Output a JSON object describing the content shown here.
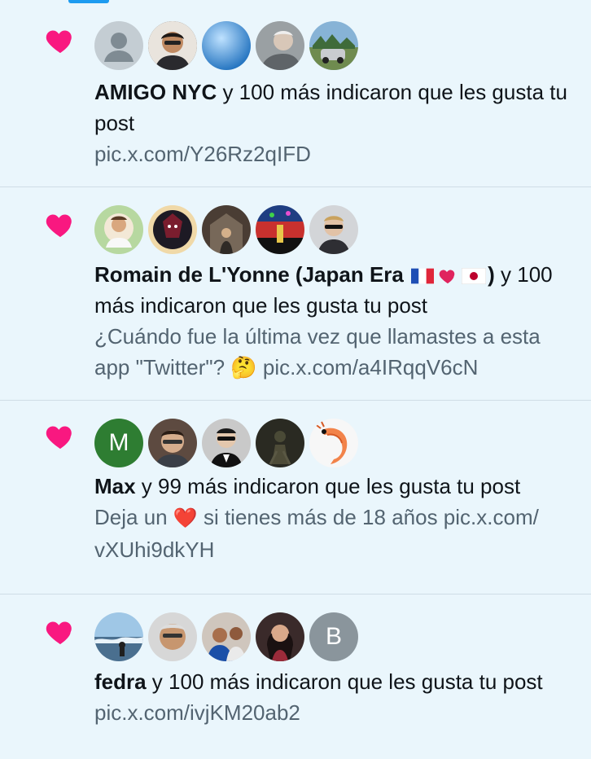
{
  "notifications": [
    {
      "name": "AMIGO NYC",
      "action": " y 100 más indicaron que les gusta tu post",
      "body": "pic.x.com/Y26Rz2qIFD",
      "avatars": [
        {
          "kind": "default-avatar",
          "color": "#c4cdd3"
        },
        {
          "kind": "photo",
          "color": "#3b2f2a"
        },
        {
          "kind": "photo",
          "color": "#2f87c9"
        },
        {
          "kind": "photo",
          "color": "#8b8f91"
        },
        {
          "kind": "photo",
          "color": "#6a8f5a"
        }
      ]
    },
    {
      "name_part1": "Romain de L'Yonne (Japan Era ",
      "name_part2": ")",
      "action": " y 100 más indicaron que les gusta tu post",
      "body_part1": "¿Cuándo fue la última vez que llamastes a esta app \"Twitter\"? ",
      "emoji_thinking": "🤔",
      "body_part2": " pic.x.com/a4IRqqV6cN",
      "avatars": [
        {
          "kind": "photo",
          "color": "#d9c8a7"
        },
        {
          "kind": "photo",
          "color": "#3a2a3e"
        },
        {
          "kind": "photo",
          "color": "#6b5b4b"
        },
        {
          "kind": "photo",
          "color": "#1f3e82"
        },
        {
          "kind": "photo",
          "color": "#b8b8b8"
        }
      ]
    },
    {
      "name": "Max",
      "action": " y 99 más indicaron que les gusta tu post",
      "body_part1": "Deja un ",
      "emoji_heart": "❤️",
      "body_part2": " si tienes más de 18 años pic.x.com/ vXUhi9dkYH",
      "avatars": [
        {
          "kind": "letter",
          "letter": "M",
          "color": "#2e7d32"
        },
        {
          "kind": "photo",
          "color": "#6e5a4e"
        },
        {
          "kind": "photo",
          "color": "#2b2b2b"
        },
        {
          "kind": "photo",
          "color": "#2a2a22"
        },
        {
          "kind": "shrimp",
          "color": "#f2f2f2"
        }
      ]
    },
    {
      "name": "fedra",
      "action": " y 100 más indicaron que les gusta tu post",
      "body": "pic.x.com/ivjKM20ab2",
      "avatars": [
        {
          "kind": "photo",
          "color": "#7ba7c9"
        },
        {
          "kind": "photo",
          "color": "#b88a6e"
        },
        {
          "kind": "photo",
          "color": "#8a6a5a"
        },
        {
          "kind": "photo",
          "color": "#7a2f3a"
        },
        {
          "kind": "letter",
          "letter": "B",
          "color": "#8a959c"
        }
      ]
    }
  ],
  "colors": {
    "like": "#f91880",
    "link": "#536471",
    "background": "#eaf6fc"
  }
}
